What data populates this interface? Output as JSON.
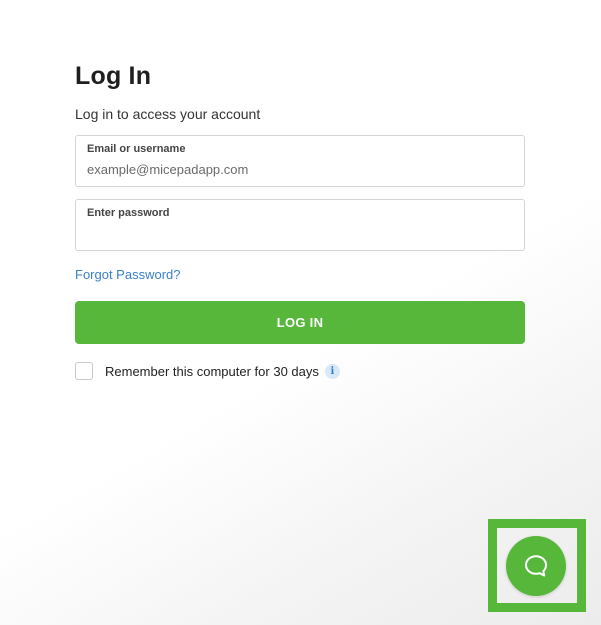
{
  "login": {
    "title": "Log In",
    "subtitle": "Log in to access your account",
    "email_label": "Email or username",
    "email_placeholder": "example@micepadapp.com",
    "password_label": "Enter password",
    "password_placeholder": "",
    "forgot_link": "Forgot Password?",
    "login_button": "LOG IN",
    "remember_label": "Remember this computer for 30 days",
    "remember_checked": false,
    "info_icon": "info-icon"
  },
  "chat": {
    "icon": "chat-bubble-icon"
  },
  "colors": {
    "accent": "#56b73b",
    "link": "#3a80c7"
  }
}
